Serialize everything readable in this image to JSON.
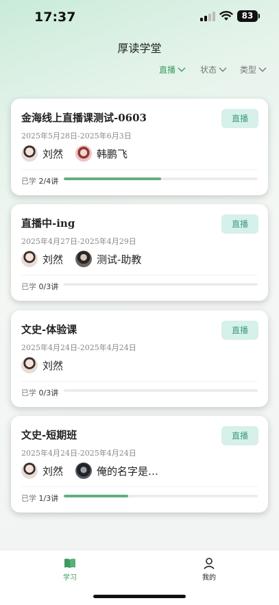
{
  "status_bar": {
    "time": "17:37",
    "battery": "83"
  },
  "header": {
    "title": "厚读学堂"
  },
  "filters": [
    {
      "label": "直播",
      "active": true
    },
    {
      "label": "状态",
      "active": false
    },
    {
      "label": "类型",
      "active": false
    }
  ],
  "courses": [
    {
      "title": "金海线上直播课测试-0603",
      "badge": "直播",
      "date": "2025年5月28日-2025年6月3日",
      "teachers": [
        "刘然",
        "韩鹏飞"
      ],
      "progress_prefix": "已学",
      "progress_count": "2/4讲",
      "progress": 0.5
    },
    {
      "title": "直播中-ing",
      "badge": "直播",
      "date": "2025年4月27日-2025年4月29日",
      "teachers": [
        "刘然",
        "测试-助教"
      ],
      "progress_prefix": "已学",
      "progress_count": "0/3讲",
      "progress": 0
    },
    {
      "title": "文史-体验课",
      "badge": "直播",
      "date": "2025年4月24日-2025年4月24日",
      "teachers": [
        "刘然"
      ],
      "progress_prefix": "已学",
      "progress_count": "0/3讲",
      "progress": 0
    },
    {
      "title": "文史-短期班",
      "badge": "直播",
      "date": "2025年4月24日-2025年4月24日",
      "teachers": [
        "刘然",
        "俺的名字是…"
      ],
      "progress_prefix": "已学",
      "progress_count": "1/3讲",
      "progress": 0.333
    }
  ],
  "tabbar": [
    {
      "label": "学习",
      "icon": "book-icon",
      "active": true
    },
    {
      "label": "我的",
      "icon": "person-icon",
      "active": false
    }
  ],
  "colors": {
    "accent": "#3d9a62",
    "badge_bg": "#d6f0ea",
    "progress": "#63b07b"
  }
}
